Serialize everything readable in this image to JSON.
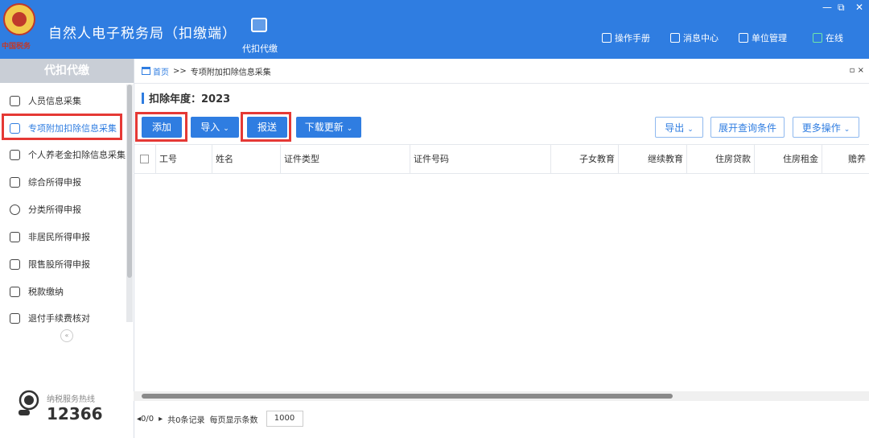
{
  "header": {
    "emblem_text": "中国税务",
    "title": "自然人电子税务局（扣缴端）",
    "nav_tab_label": "代扣代缴",
    "window_controls": [
      "—",
      "⧉",
      "✕"
    ],
    "tools": [
      {
        "label": "操作手册",
        "icon": "book-icon"
      },
      {
        "label": "消息中心",
        "icon": "mail-icon"
      },
      {
        "label": "单位管理",
        "icon": "building-icon"
      },
      {
        "label": "在线",
        "icon": "online-status-icon"
      }
    ]
  },
  "sidebar": {
    "title": "代扣代缴",
    "items": [
      {
        "label": "人员信息采集",
        "icon": "person-icon"
      },
      {
        "label": "专项附加扣除信息采集",
        "icon": "list-icon",
        "active": true
      },
      {
        "label": "个人养老金扣除信息采集",
        "icon": "pension-icon"
      },
      {
        "label": "综合所得申报",
        "icon": "layers-icon"
      },
      {
        "label": "分类所得申报",
        "icon": "pie-icon"
      },
      {
        "label": "非居民所得申报",
        "icon": "nonresident-icon"
      },
      {
        "label": "限售股所得申报",
        "icon": "bar-chart-icon"
      },
      {
        "label": "税款缴纳",
        "icon": "wallet-icon"
      },
      {
        "label": "退付手续费核对",
        "icon": "receipt-icon"
      }
    ],
    "collapse_symbol": "«",
    "hotline_label": "纳税服务热线",
    "hotline_number": "12366"
  },
  "breadcrumb": {
    "home": "首页",
    "separator": ">>",
    "current": "专项附加扣除信息采集",
    "controls": "▫ ×"
  },
  "year_label": "扣除年度：2023",
  "toolbar": {
    "add": "添加",
    "import": "导入",
    "submit": "报送",
    "download_update": "下载更新",
    "export": "导出",
    "expand_query": "展开查询条件",
    "more_actions": "更多操作",
    "caret": "⌄"
  },
  "table": {
    "columns": [
      "工号",
      "姓名",
      "证件类型",
      "证件号码",
      "子女教育",
      "继续教育",
      "住房贷款",
      "住房租金",
      "赡养"
    ]
  },
  "pager": {
    "page": "0/0",
    "total": "共0条记录",
    "per_page_label": "每页显示条数",
    "per_page_value": "1000"
  },
  "colors": {
    "brand_blue": "#2f7de1",
    "highlight_red": "#e53935"
  }
}
